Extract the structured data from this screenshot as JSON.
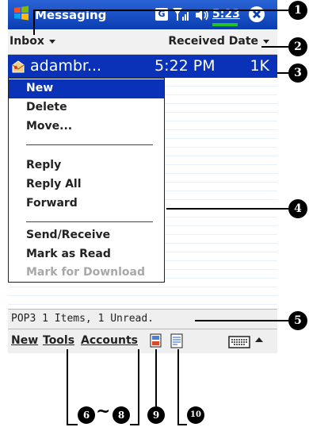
{
  "titlebar": {
    "app_title": "Messaging",
    "status_g": "G",
    "time": "5:23"
  },
  "header": {
    "folder": "Inbox",
    "sort": "Received Date"
  },
  "message": {
    "sender": "adambr...",
    "time": "5:22 PM",
    "size": "1K"
  },
  "menu": {
    "new": "New",
    "delete": "Delete",
    "move": "Move...",
    "reply": "Reply",
    "reply_all": "Reply All",
    "forward": "Forward",
    "send_receive": "Send/Receive",
    "mark_read": "Mark as Read",
    "mark_download": "Mark for Download"
  },
  "status": {
    "text": "POP3  1 Items, 1 Unread."
  },
  "toolbar": {
    "new": "New",
    "tools": "Tools",
    "accounts": "Accounts"
  },
  "callouts": {
    "c1": "1",
    "c2": "2",
    "c3": "3",
    "c4": "4",
    "c5": "5",
    "c6": "6",
    "tilde": "~",
    "c8": "8",
    "c9": "9",
    "c10": "10"
  }
}
